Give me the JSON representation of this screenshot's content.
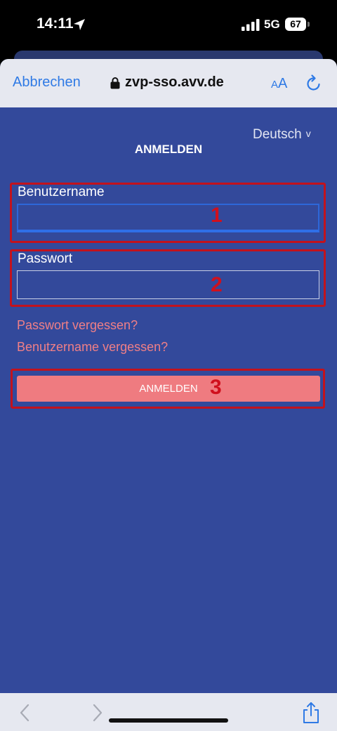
{
  "status_bar": {
    "time": "14:11",
    "location_icon": "location-arrow-icon",
    "signal_icon": "signal-bars-icon",
    "network": "5G",
    "battery": "67"
  },
  "browser": {
    "cancel_label": "Abbrechen",
    "url": "zvp-sso.avv.de",
    "lock_icon": "lock-icon",
    "text_size_small": "A",
    "text_size_big": "A",
    "reload_icon": "reload-icon",
    "accent_color": "#2f7ae5"
  },
  "page": {
    "language": "Deutsch",
    "language_chevron": "v",
    "title": "ANMELDEN",
    "username_label": "Benutzername",
    "username_value": "",
    "password_label": "Passwort",
    "password_value": "",
    "forgot_password": "Passwort vergessen?",
    "forgot_username": "Benutzername vergessen?",
    "submit_label": "ANMELDEN",
    "background_color": "#33499b",
    "link_color": "#f07f86",
    "button_color": "#ef7b80"
  },
  "annotations": {
    "marker_1": "1",
    "marker_2": "2",
    "marker_3": "3",
    "color": "#c2121d"
  },
  "bottom_bar": {
    "back_icon": "chevron-left-icon",
    "forward_icon": "chevron-right-icon",
    "share_icon": "share-icon"
  }
}
